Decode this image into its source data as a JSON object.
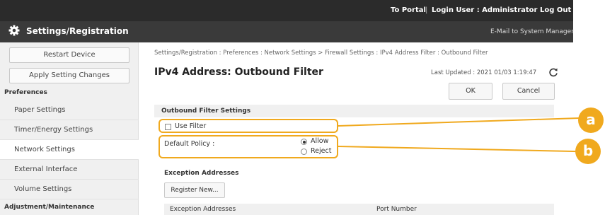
{
  "header": {
    "title": "Settings/Registration",
    "links": {
      "portal": "To Portal",
      "login_user": "Login User : Administrator",
      "logout": "Log Out",
      "email": "E-Mail to System Manager"
    }
  },
  "sidebar": {
    "restart_button": "Restart Device",
    "apply_button": "Apply Setting Changes",
    "section_preferences": "Preferences",
    "items": [
      "Paper Settings",
      "Timer/Energy Settings",
      "Network Settings",
      "External Interface",
      "Volume Settings"
    ],
    "active_item": "Network Settings",
    "section_adjustment": "Adjustment/Maintenance"
  },
  "main": {
    "breadcrumb": "Settings/Registration : Preferences : Network Settings > Firewall Settings : IPv4 Address Filter : Outbound Filter",
    "page_title": "IPv4 Address: Outbound Filter",
    "last_updated": "Last Updated : 2021 01/03 1:19:47",
    "ok_button": "OK",
    "cancel_button": "Cancel",
    "outbound_section": "Outbound Filter Settings",
    "use_filter_label": "Use Filter",
    "use_filter_checked": false,
    "default_policy_label": "Default Policy :",
    "policy_options": [
      "Allow",
      "Reject"
    ],
    "policy_selected": "Allow",
    "exception_section": "Exception Addresses",
    "register_button": "Register New...",
    "table_headers": [
      "Exception Addresses",
      "Port Number"
    ]
  },
  "annotations": {
    "callout_a": "a",
    "callout_b": "b",
    "color": "#f0a91e"
  }
}
